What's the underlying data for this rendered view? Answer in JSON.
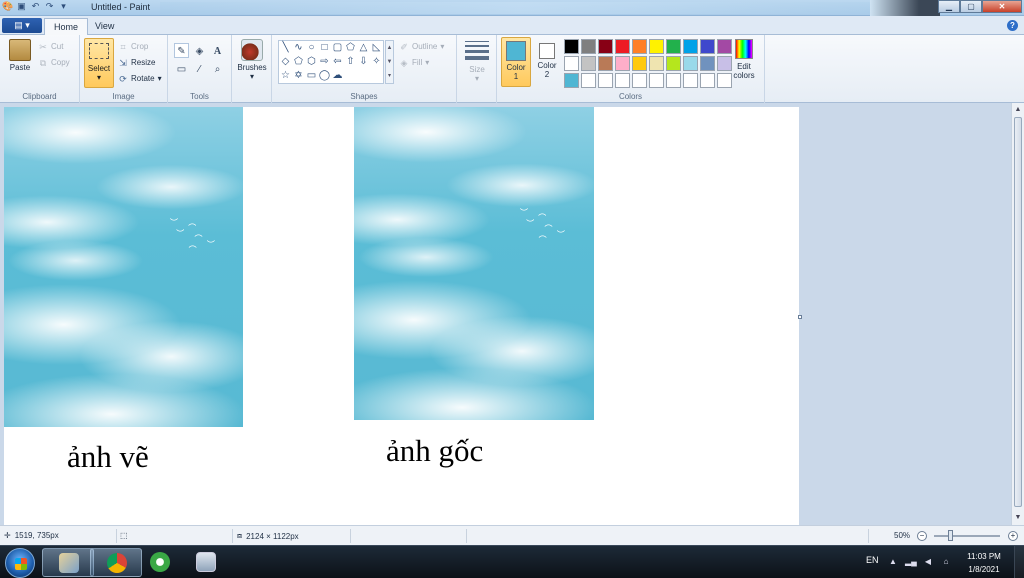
{
  "app": {
    "title": "Untitled - Paint"
  },
  "tabs": {
    "file_label": "",
    "home": "Home",
    "view": "View"
  },
  "ribbon": {
    "clipboard": {
      "group": "Clipboard",
      "paste": "Paste",
      "cut": "Cut",
      "copy": "Copy"
    },
    "image": {
      "group": "Image",
      "select": "Select",
      "crop": "Crop",
      "resize": "Resize",
      "rotate": "Rotate"
    },
    "tools": {
      "group": "Tools"
    },
    "brushes": {
      "label": "Brushes"
    },
    "shapes": {
      "group": "Shapes",
      "outline": "Outline",
      "fill": "Fill"
    },
    "size": {
      "label": "Size"
    },
    "colors": {
      "group": "Colors",
      "color1_label": "Color",
      "color1_num": "1",
      "color2_label": "Color",
      "color2_num": "2",
      "color1_value": "#4fb6d3",
      "color2_value": "#ffffff",
      "edit_label_1": "Edit",
      "edit_label_2": "colors",
      "palette": [
        "#000000",
        "#7f7f7f",
        "#880015",
        "#ed1c24",
        "#ff7f27",
        "#fff200",
        "#22b14c",
        "#00a2e8",
        "#3f48cc",
        "#a349a4",
        "#ffffff",
        "#c3c3c3",
        "#b97a57",
        "#ffaec9",
        "#ffc90e",
        "#efe4b0",
        "#b5e61d",
        "#99d9ea",
        "#7092be",
        "#c8bfe7",
        "#4fb6d3",
        "#ffffff",
        "#ffffff",
        "#ffffff",
        "#ffffff",
        "#ffffff",
        "#ffffff",
        "#ffffff",
        "#ffffff",
        "#ffffff"
      ]
    }
  },
  "canvas": {
    "caption_left": "ảnh vẽ",
    "caption_right": "ảnh gốc"
  },
  "status": {
    "cursor_pos": "1519, 735px",
    "image_size": "2124 × 1122px",
    "zoom": "50%"
  },
  "taskbar": {
    "language": "EN",
    "time": "11:03 PM",
    "date": "1/8/2021"
  }
}
